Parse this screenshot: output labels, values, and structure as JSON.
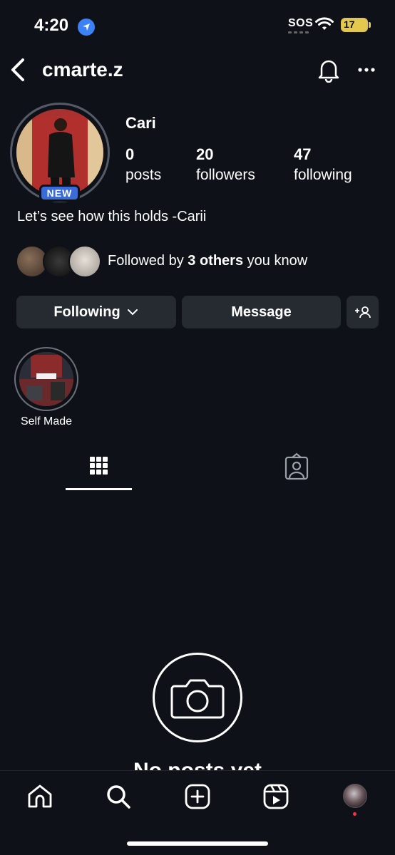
{
  "status_bar": {
    "time": "4:20",
    "sos": "SOS",
    "battery": "17"
  },
  "header": {
    "username": "cmarte.z"
  },
  "profile": {
    "display_name": "Cari",
    "badge": "NEW",
    "stats": [
      {
        "value": "0",
        "label": "posts"
      },
      {
        "value": "20",
        "label": "followers"
      },
      {
        "value": "47",
        "label": "following"
      }
    ],
    "bio": "Let’s see how this holds -Carii",
    "followed_by": {
      "prefix": "Followed by ",
      "bold": "3 others",
      "suffix": " you know"
    }
  },
  "actions": {
    "following": "Following",
    "message": "Message"
  },
  "highlights": [
    {
      "label": "Self Made"
    }
  ],
  "tabs": [
    {
      "icon": "grid-icon",
      "active": true
    },
    {
      "icon": "tagged-icon",
      "active": false
    }
  ],
  "empty_state": {
    "title": "No posts yet"
  },
  "bottom_nav": [
    {
      "icon": "home-icon"
    },
    {
      "icon": "search-icon"
    },
    {
      "icon": "create-icon"
    },
    {
      "icon": "reels-icon"
    },
    {
      "icon": "profile-avatar"
    }
  ],
  "colors": {
    "background": "#0e1117",
    "button": "#262a31",
    "badge": "#3a6bd6",
    "accent_blue": "#3b82f6"
  }
}
